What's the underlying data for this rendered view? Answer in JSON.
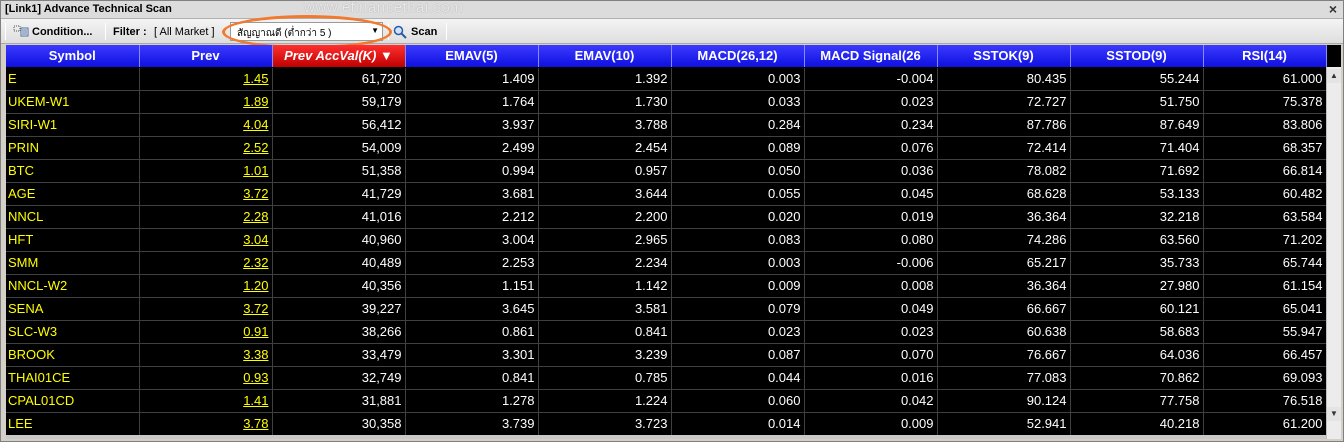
{
  "window": {
    "title": "[Link1] Advance Technical Scan",
    "close_glyph": "×"
  },
  "watermark": "www.efinancethai.com",
  "toolbar": {
    "condition_label": "Condition...",
    "condition_icon": "grid-settings-icon",
    "filter_label": "Filter :",
    "market_value": "[ All Market ]",
    "combo_value": "สัญญาณดี (ต่ำกว่า 5 )",
    "scan_label": "Scan",
    "scan_icon": "magnifier-icon",
    "accent_color": "#f07a30"
  },
  "grid": {
    "columns": [
      "Symbol",
      "Prev",
      "Prev AccVal(K) ▼",
      "EMAV(5)",
      "EMAV(10)",
      "MACD(26,12)",
      "MACD Signal(26",
      "SSTOK(9)",
      "SSTOD(9)",
      "RSI(14)"
    ],
    "sorted_column": "Prev AccVal(K) ▼",
    "rows": [
      [
        "E",
        "1.45",
        "61,720",
        "1.409",
        "1.392",
        "0.003",
        "-0.004",
        "80.435",
        "55.244",
        "61.000"
      ],
      [
        "UKEM-W1",
        "1.89",
        "59,179",
        "1.764",
        "1.730",
        "0.033",
        "0.023",
        "72.727",
        "51.750",
        "75.378"
      ],
      [
        "SIRI-W1",
        "4.04",
        "56,412",
        "3.937",
        "3.788",
        "0.284",
        "0.234",
        "87.786",
        "87.649",
        "83.806"
      ],
      [
        "PRIN",
        "2.52",
        "54,009",
        "2.499",
        "2.454",
        "0.089",
        "0.076",
        "72.414",
        "71.404",
        "68.357"
      ],
      [
        "BTC",
        "1.01",
        "51,358",
        "0.994",
        "0.957",
        "0.050",
        "0.036",
        "78.082",
        "71.692",
        "66.814"
      ],
      [
        "AGE",
        "3.72",
        "41,729",
        "3.681",
        "3.644",
        "0.055",
        "0.045",
        "68.628",
        "53.133",
        "60.482"
      ],
      [
        "NNCL",
        "2.28",
        "41,016",
        "2.212",
        "2.200",
        "0.020",
        "0.019",
        "36.364",
        "32.218",
        "63.584"
      ],
      [
        "HFT",
        "3.04",
        "40,960",
        "3.004",
        "2.965",
        "0.083",
        "0.080",
        "74.286",
        "63.560",
        "71.202"
      ],
      [
        "SMM",
        "2.32",
        "40,489",
        "2.253",
        "2.234",
        "0.003",
        "-0.006",
        "65.217",
        "35.733",
        "65.744"
      ],
      [
        "NNCL-W2",
        "1.20",
        "40,356",
        "1.151",
        "1.142",
        "0.009",
        "0.008",
        "36.364",
        "27.980",
        "61.154"
      ],
      [
        "SENA",
        "3.72",
        "39,227",
        "3.645",
        "3.581",
        "0.079",
        "0.049",
        "66.667",
        "60.121",
        "65.041"
      ],
      [
        "SLC-W3",
        "0.91",
        "38,266",
        "0.861",
        "0.841",
        "0.023",
        "0.023",
        "60.638",
        "58.683",
        "55.947"
      ],
      [
        "BROOK",
        "3.38",
        "33,479",
        "3.301",
        "3.239",
        "0.087",
        "0.070",
        "76.667",
        "64.036",
        "66.457"
      ],
      [
        "THAI01CE",
        "0.93",
        "32,749",
        "0.841",
        "0.785",
        "0.044",
        "0.016",
        "77.083",
        "70.862",
        "69.093"
      ],
      [
        "CPAL01CD",
        "1.41",
        "31,881",
        "1.278",
        "1.224",
        "0.060",
        "0.042",
        "90.124",
        "77.758",
        "76.518"
      ],
      [
        "LEE",
        "3.78",
        "30,358",
        "3.739",
        "3.723",
        "0.014",
        "0.009",
        "52.941",
        "40.218",
        "61.200"
      ]
    ]
  },
  "scrollbar": {
    "up_glyph": "▲",
    "down_glyph": "▼"
  }
}
